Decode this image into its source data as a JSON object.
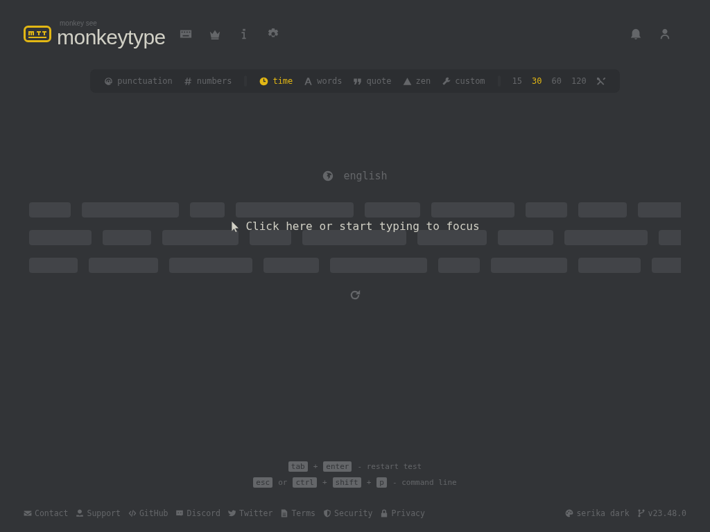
{
  "header": {
    "logo_sub": "monkey see",
    "logo": "monkeytype",
    "nav": [
      {
        "kind": "keyboard"
      },
      {
        "kind": "crown"
      },
      {
        "kind": "info"
      },
      {
        "kind": "gear"
      }
    ],
    "account": [
      {
        "kind": "bell"
      },
      {
        "kind": "user"
      }
    ]
  },
  "config_bar": {
    "toggles": [
      {
        "kind": "at",
        "label": "punctuation",
        "selected": false
      },
      {
        "kind": "hash",
        "label": "numbers",
        "selected": false
      }
    ],
    "modes": [
      {
        "kind": "clock",
        "label": "time",
        "selected": true
      },
      {
        "kind": "font",
        "label": "words",
        "selected": false
      },
      {
        "kind": "quote",
        "label": "quote",
        "selected": false
      },
      {
        "kind": "mountain",
        "label": "zen",
        "selected": false
      },
      {
        "kind": "wrench",
        "label": "custom",
        "selected": false
      }
    ],
    "durations": [
      {
        "label": "15",
        "selected": false
      },
      {
        "label": "30",
        "selected": true
      },
      {
        "label": "60",
        "selected": false
      },
      {
        "label": "120",
        "selected": false
      }
    ]
  },
  "language": "english",
  "focus_message": "Click here or start typing to focus",
  "hints": [
    [
      {
        "kind": "key",
        "text": "tab"
      },
      {
        "kind": "text",
        "text": "+"
      },
      {
        "kind": "key",
        "text": "enter"
      },
      {
        "kind": "text",
        "text": "- restart test"
      }
    ],
    [
      {
        "kind": "key",
        "text": "esc"
      },
      {
        "kind": "text",
        "text": "or"
      },
      {
        "kind": "key",
        "text": "ctrl"
      },
      {
        "kind": "text",
        "text": "+"
      },
      {
        "kind": "key",
        "text": "shift"
      },
      {
        "kind": "text",
        "text": "+"
      },
      {
        "kind": "key",
        "text": "p"
      },
      {
        "kind": "text",
        "text": "- command line"
      }
    ]
  ],
  "footer": {
    "links": [
      {
        "kind": "envelope",
        "label": "Contact"
      },
      {
        "kind": "donate",
        "label": "Support"
      },
      {
        "kind": "code",
        "label": "GitHub"
      },
      {
        "kind": "discord",
        "label": "Discord"
      },
      {
        "kind": "bird",
        "label": "Twitter"
      },
      {
        "kind": "document",
        "label": "Terms"
      },
      {
        "kind": "shield",
        "label": "Security"
      },
      {
        "kind": "lock",
        "label": "Privacy"
      }
    ],
    "right": [
      {
        "kind": "palette",
        "label": "serika dark"
      },
      {
        "kind": "branch",
        "label": "v23.48.0"
      }
    ]
  }
}
